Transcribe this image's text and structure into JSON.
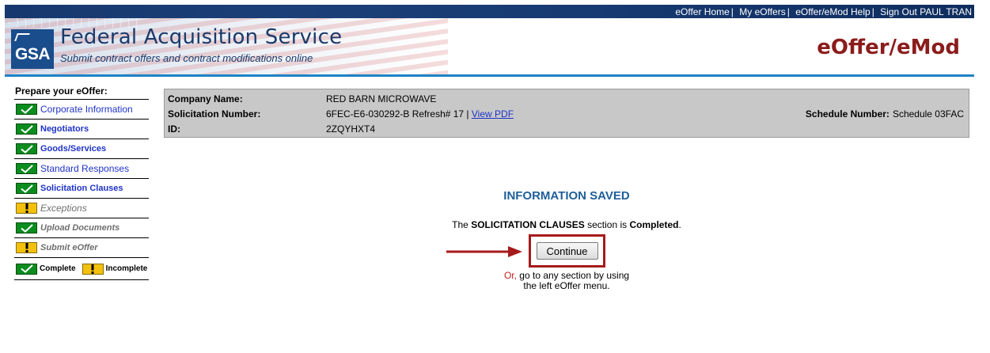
{
  "topnav": {
    "links": [
      "eOffer Home",
      "My eOffers",
      "eOffer/eMod Help",
      "Sign Out PAUL TRAN"
    ]
  },
  "header": {
    "logo_text": "GSA",
    "title": "Federal Acquisition Service",
    "subtitle": "Submit contract offers and contract modifications online",
    "app_name": "eOffer/eMod"
  },
  "menu": {
    "heading": "Prepare your eOffer:",
    "items": [
      {
        "label": "Corporate Information",
        "status": "complete"
      },
      {
        "label": "Negotiators",
        "status": "complete"
      },
      {
        "label": "Goods/Services",
        "status": "complete"
      },
      {
        "label": "Standard Responses",
        "status": "complete"
      },
      {
        "label": "Solicitation Clauses",
        "status": "complete"
      },
      {
        "label": "Exceptions",
        "status": "incomplete"
      },
      {
        "label": "Upload Documents",
        "status": "complete"
      },
      {
        "label": "Submit eOffer",
        "status": "incomplete"
      }
    ],
    "legend": {
      "complete": "Complete",
      "incomplete": "Incomplete"
    }
  },
  "info": {
    "company_label": "Company Name:",
    "company_value": "RED BARN MICROWAVE",
    "solicitation_label": "Solicitation Number:",
    "solicitation_value": "6FEC-E6-030292-B Refresh# 17 |",
    "view_pdf": "View PDF",
    "id_label": "ID:",
    "id_value": "2ZQYHXT4",
    "schedule_label": "Schedule Number:",
    "schedule_value": "Schedule 03FAC"
  },
  "main": {
    "saved_title": "INFORMATION SAVED",
    "msg_the": "The",
    "msg_section": "SOLICITATION CLAUSES",
    "msg_middle": "section is",
    "msg_status": "Completed",
    "msg_end": ".",
    "continue_label": "Continue",
    "alt_or": "Or,",
    "alt_line1": "go to any section by using",
    "alt_line2": "the left eOffer menu."
  },
  "colors": {
    "header_blue": "#16386e",
    "brand_red": "#8b1c1c",
    "complete_green": "#0b8c1f",
    "incomplete_yellow": "#f3c10d",
    "link_blue": "#1f33c7",
    "highlight_red": "#a61b1b"
  }
}
